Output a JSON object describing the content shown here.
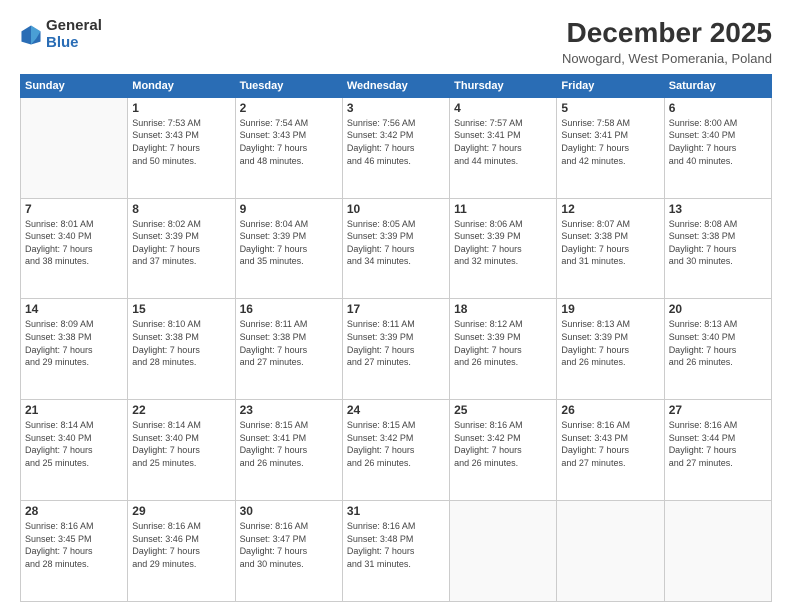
{
  "logo": {
    "general": "General",
    "blue": "Blue"
  },
  "title": "December 2025",
  "subtitle": "Nowogard, West Pomerania, Poland",
  "weekdays": [
    "Sunday",
    "Monday",
    "Tuesday",
    "Wednesday",
    "Thursday",
    "Friday",
    "Saturday"
  ],
  "weeks": [
    [
      {
        "day": "",
        "info": ""
      },
      {
        "day": "1",
        "info": "Sunrise: 7:53 AM\nSunset: 3:43 PM\nDaylight: 7 hours\nand 50 minutes."
      },
      {
        "day": "2",
        "info": "Sunrise: 7:54 AM\nSunset: 3:43 PM\nDaylight: 7 hours\nand 48 minutes."
      },
      {
        "day": "3",
        "info": "Sunrise: 7:56 AM\nSunset: 3:42 PM\nDaylight: 7 hours\nand 46 minutes."
      },
      {
        "day": "4",
        "info": "Sunrise: 7:57 AM\nSunset: 3:41 PM\nDaylight: 7 hours\nand 44 minutes."
      },
      {
        "day": "5",
        "info": "Sunrise: 7:58 AM\nSunset: 3:41 PM\nDaylight: 7 hours\nand 42 minutes."
      },
      {
        "day": "6",
        "info": "Sunrise: 8:00 AM\nSunset: 3:40 PM\nDaylight: 7 hours\nand 40 minutes."
      }
    ],
    [
      {
        "day": "7",
        "info": "Sunrise: 8:01 AM\nSunset: 3:40 PM\nDaylight: 7 hours\nand 38 minutes."
      },
      {
        "day": "8",
        "info": "Sunrise: 8:02 AM\nSunset: 3:39 PM\nDaylight: 7 hours\nand 37 minutes."
      },
      {
        "day": "9",
        "info": "Sunrise: 8:04 AM\nSunset: 3:39 PM\nDaylight: 7 hours\nand 35 minutes."
      },
      {
        "day": "10",
        "info": "Sunrise: 8:05 AM\nSunset: 3:39 PM\nDaylight: 7 hours\nand 34 minutes."
      },
      {
        "day": "11",
        "info": "Sunrise: 8:06 AM\nSunset: 3:39 PM\nDaylight: 7 hours\nand 32 minutes."
      },
      {
        "day": "12",
        "info": "Sunrise: 8:07 AM\nSunset: 3:38 PM\nDaylight: 7 hours\nand 31 minutes."
      },
      {
        "day": "13",
        "info": "Sunrise: 8:08 AM\nSunset: 3:38 PM\nDaylight: 7 hours\nand 30 minutes."
      }
    ],
    [
      {
        "day": "14",
        "info": "Sunrise: 8:09 AM\nSunset: 3:38 PM\nDaylight: 7 hours\nand 29 minutes."
      },
      {
        "day": "15",
        "info": "Sunrise: 8:10 AM\nSunset: 3:38 PM\nDaylight: 7 hours\nand 28 minutes."
      },
      {
        "day": "16",
        "info": "Sunrise: 8:11 AM\nSunset: 3:38 PM\nDaylight: 7 hours\nand 27 minutes."
      },
      {
        "day": "17",
        "info": "Sunrise: 8:11 AM\nSunset: 3:39 PM\nDaylight: 7 hours\nand 27 minutes."
      },
      {
        "day": "18",
        "info": "Sunrise: 8:12 AM\nSunset: 3:39 PM\nDaylight: 7 hours\nand 26 minutes."
      },
      {
        "day": "19",
        "info": "Sunrise: 8:13 AM\nSunset: 3:39 PM\nDaylight: 7 hours\nand 26 minutes."
      },
      {
        "day": "20",
        "info": "Sunrise: 8:13 AM\nSunset: 3:40 PM\nDaylight: 7 hours\nand 26 minutes."
      }
    ],
    [
      {
        "day": "21",
        "info": "Sunrise: 8:14 AM\nSunset: 3:40 PM\nDaylight: 7 hours\nand 25 minutes."
      },
      {
        "day": "22",
        "info": "Sunrise: 8:14 AM\nSunset: 3:40 PM\nDaylight: 7 hours\nand 25 minutes."
      },
      {
        "day": "23",
        "info": "Sunrise: 8:15 AM\nSunset: 3:41 PM\nDaylight: 7 hours\nand 26 minutes."
      },
      {
        "day": "24",
        "info": "Sunrise: 8:15 AM\nSunset: 3:42 PM\nDaylight: 7 hours\nand 26 minutes."
      },
      {
        "day": "25",
        "info": "Sunrise: 8:16 AM\nSunset: 3:42 PM\nDaylight: 7 hours\nand 26 minutes."
      },
      {
        "day": "26",
        "info": "Sunrise: 8:16 AM\nSunset: 3:43 PM\nDaylight: 7 hours\nand 27 minutes."
      },
      {
        "day": "27",
        "info": "Sunrise: 8:16 AM\nSunset: 3:44 PM\nDaylight: 7 hours\nand 27 minutes."
      }
    ],
    [
      {
        "day": "28",
        "info": "Sunrise: 8:16 AM\nSunset: 3:45 PM\nDaylight: 7 hours\nand 28 minutes."
      },
      {
        "day": "29",
        "info": "Sunrise: 8:16 AM\nSunset: 3:46 PM\nDaylight: 7 hours\nand 29 minutes."
      },
      {
        "day": "30",
        "info": "Sunrise: 8:16 AM\nSunset: 3:47 PM\nDaylight: 7 hours\nand 30 minutes."
      },
      {
        "day": "31",
        "info": "Sunrise: 8:16 AM\nSunset: 3:48 PM\nDaylight: 7 hours\nand 31 minutes."
      },
      {
        "day": "",
        "info": ""
      },
      {
        "day": "",
        "info": ""
      },
      {
        "day": "",
        "info": ""
      }
    ]
  ]
}
